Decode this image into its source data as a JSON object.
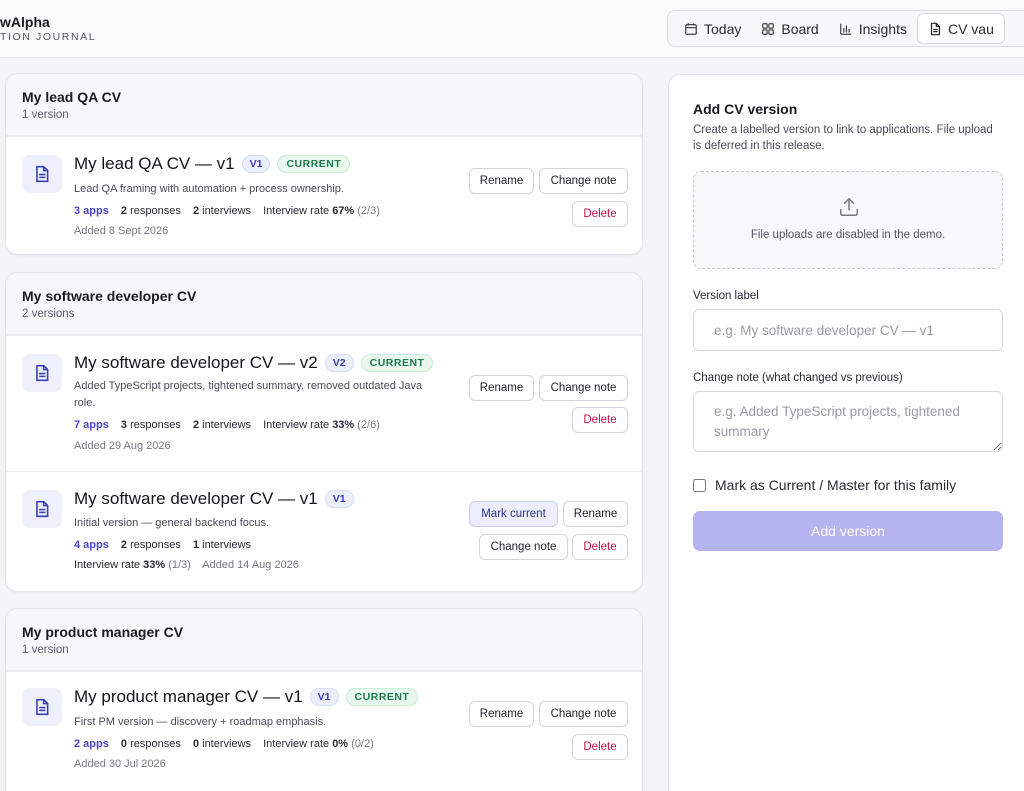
{
  "app": {
    "brand_title": "wAlpha",
    "brand_subtitle": "TION JOURNAL"
  },
  "nav": {
    "items": [
      {
        "label": "Today",
        "icon": "calendar-icon"
      },
      {
        "label": "Board",
        "icon": "grid-icon"
      },
      {
        "label": "Insights",
        "icon": "bar-chart-icon"
      },
      {
        "label": "CV vau",
        "icon": "document-icon",
        "active": true
      }
    ]
  },
  "families": [
    {
      "title": "My lead QA CV",
      "count": "1 version",
      "versions": [
        {
          "name": "My lead QA CV — v1",
          "badge": "V1",
          "current_label": "CURRENT",
          "note": "Lead QA framing with automation + process ownership.",
          "apps": "3 apps",
          "responses_num": "2",
          "responses_label": "responses",
          "interviews_num": "2",
          "interviews_label": "interviews",
          "rate_label": "Interview rate",
          "rate_value": "67%",
          "rate_detail": "(2/3)",
          "added": "Added 8 Sept 2026",
          "rename_label": "Rename",
          "change_note_label": "Change note",
          "delete_label": "Delete"
        }
      ]
    },
    {
      "title": "My software developer CV",
      "count": "2 versions",
      "versions": [
        {
          "name": "My software developer CV — v2",
          "badge": "V2",
          "current_label": "CURRENT",
          "note": "Added TypeScript projects, tightened summary, removed outdated Java role.",
          "apps": "7 apps",
          "responses_num": "3",
          "responses_label": "responses",
          "interviews_num": "2",
          "interviews_label": "interviews",
          "rate_label": "Interview rate",
          "rate_value": "33%",
          "rate_detail": "(2/6)",
          "added": "Added 29 Aug 2026",
          "rename_label": "Rename",
          "change_note_label": "Change note",
          "delete_label": "Delete"
        },
        {
          "name": "My software developer CV — v1",
          "badge": "V1",
          "note": "Initial version — general backend focus.",
          "apps": "4 apps",
          "responses_num": "2",
          "responses_label": "responses",
          "interviews_num": "1",
          "interviews_label": "interviews",
          "rate_label": "Interview rate",
          "rate_value": "33%",
          "rate_detail": "(1/3)",
          "added": "Added 14 Aug 2026",
          "mark_current_label": "Mark current",
          "rename_label": "Rename",
          "change_note_label": "Change note",
          "delete_label": "Delete"
        }
      ]
    },
    {
      "title": "My product manager CV",
      "count": "1 version",
      "versions": [
        {
          "name": "My product manager CV — v1",
          "badge": "V1",
          "current_label": "CURRENT",
          "note": "First PM version — discovery + roadmap emphasis.",
          "apps": "2 apps",
          "responses_num": "0",
          "responses_label": "responses",
          "interviews_num": "0",
          "interviews_label": "interviews",
          "rate_label": "Interview rate",
          "rate_value": "0%",
          "rate_detail": "(0/2)",
          "added": "Added 30 Jul 2026",
          "rename_label": "Rename",
          "change_note_label": "Change note",
          "delete_label": "Delete"
        }
      ]
    }
  ],
  "panel": {
    "title": "Add CV version",
    "description": "Create a labelled version to link to applications. File upload is deferred in this release.",
    "dropzone_text": "File uploads are disabled in the demo.",
    "version_label": "Version label",
    "version_placeholder": "e.g. My software developer CV — v1",
    "change_note_label": "Change note (what changed vs previous)",
    "change_note_placeholder": "e.g. Added TypeScript projects, tightened summary",
    "mark_current_label": "Mark as Current / Master for this family",
    "add_button": "Add version"
  },
  "colors": {
    "accent": "#4a46c8",
    "current_badge": "#1f7a4d",
    "danger": "#c4124a",
    "add_button_disabled": "#b6b3f1"
  }
}
